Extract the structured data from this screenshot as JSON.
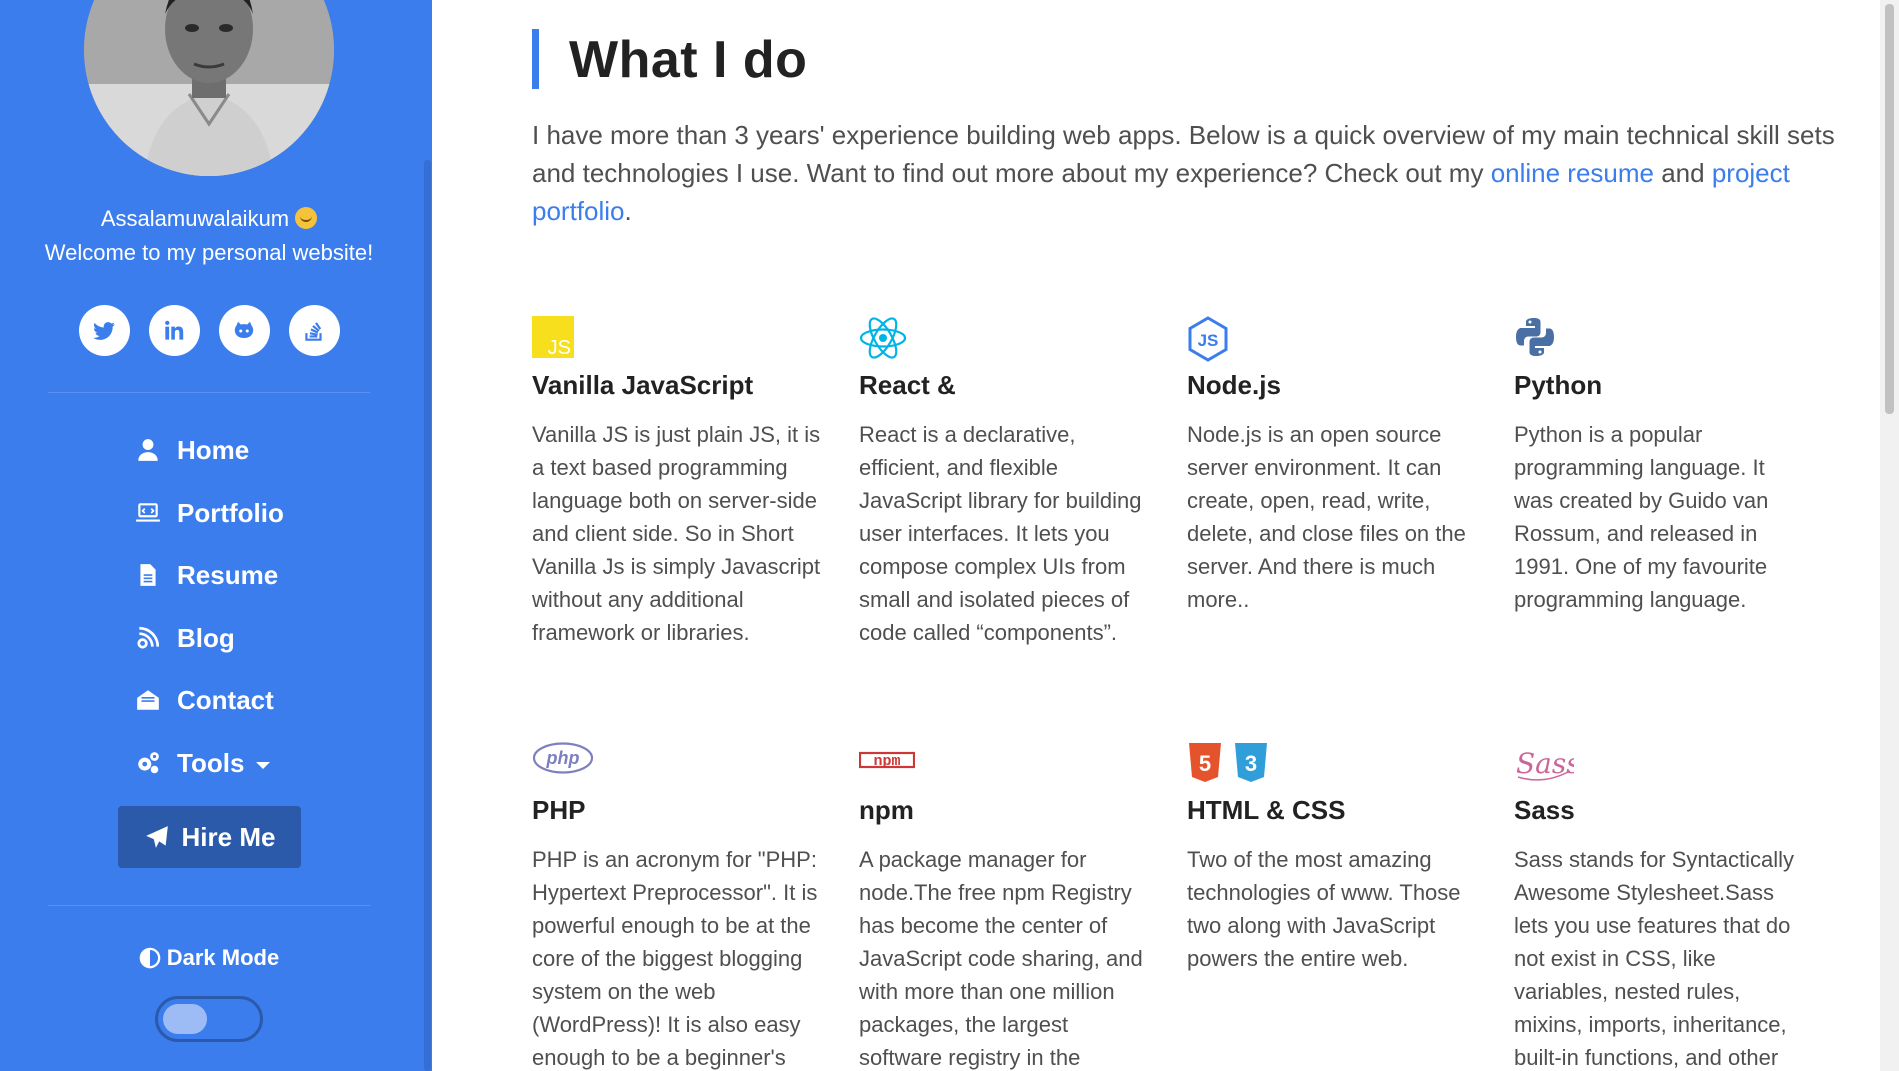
{
  "sidebar": {
    "greeting_line1": "Assalamuwalaikum",
    "greeting_line2": "Welcome to my personal website!",
    "social": [
      {
        "name": "twitter",
        "icon": "twitter-icon"
      },
      {
        "name": "linkedin",
        "icon": "linkedin-icon"
      },
      {
        "name": "github",
        "icon": "github-icon"
      },
      {
        "name": "stackoverflow",
        "icon": "stackoverflow-icon"
      }
    ],
    "nav": [
      {
        "label": "Home",
        "icon": "user-icon"
      },
      {
        "label": "Portfolio",
        "icon": "laptop-code-icon"
      },
      {
        "label": "Resume",
        "icon": "file-icon"
      },
      {
        "label": "Blog",
        "icon": "blog-icon"
      },
      {
        "label": "Contact",
        "icon": "envelope-open-icon"
      },
      {
        "label": "Tools",
        "icon": "cogs-icon"
      }
    ],
    "hire_label": "Hire Me",
    "dark_mode_label": "Dark Mode",
    "dark_mode_on": false,
    "accent": "#3b7ded",
    "button_color": "#2a5aa9"
  },
  "main": {
    "heading": "What I do",
    "intro_text": "I have more than 3 years' experience building web apps. Below is a quick overview of my main technical skill sets and technologies I use. Want to find out more about my experience? Check out my ",
    "link_resume": "online resume",
    "intro_and": " and ",
    "link_portfolio": "project portfolio",
    "intro_end": ".",
    "skills": [
      {
        "title": "Vanilla JavaScript",
        "icon": "javascript-icon",
        "description": "Vanilla JS is just plain JS, it is a text based programming language both on server-side and client side. So in Short Vanilla Js is simply Javascript without any additional framework or libraries."
      },
      {
        "title": "React &",
        "icon": "react-icon",
        "description": "React is a declarative, efficient, and flexible JavaScript library for building user interfaces. It lets you compose complex UIs from small and isolated pieces of code called “components”."
      },
      {
        "title": "Node.js",
        "icon": "nodejs-icon",
        "description": "Node.js is an open source server environment. It can create, open, read, write, delete, and close files on the server. And there is much more.."
      },
      {
        "title": "Python",
        "icon": "python-icon",
        "description": "Python is a popular programming language. It was created by Guido van Rossum, and released in 1991. One of my favourite programming language."
      },
      {
        "title": "PHP",
        "icon": "php-icon",
        "description": "PHP is an acronym for \"PHP: Hypertext Preprocessor\". It is powerful enough to be at the core of the biggest blogging system on the web (WordPress)! It is also easy enough to be a beginner's"
      },
      {
        "title": "npm",
        "icon": "npm-icon",
        "description": "A package manager for node.The free npm Registry has become the center of JavaScript code sharing, and with more than one million packages, the largest software registry in the"
      },
      {
        "title": "HTML & CSS",
        "icon": "html5-css3-icon",
        "description": "Two of the most amazing technologies of www. Those two along with JavaScript powers the entire web."
      },
      {
        "title": "Sass",
        "icon": "sass-icon",
        "description": "Sass stands for Syntactically Awesome Stylesheet.Sass lets you use features that do not exist in CSS, like variables, nested rules, mixins, imports, inheritance, built-in functions, and other"
      }
    ]
  }
}
